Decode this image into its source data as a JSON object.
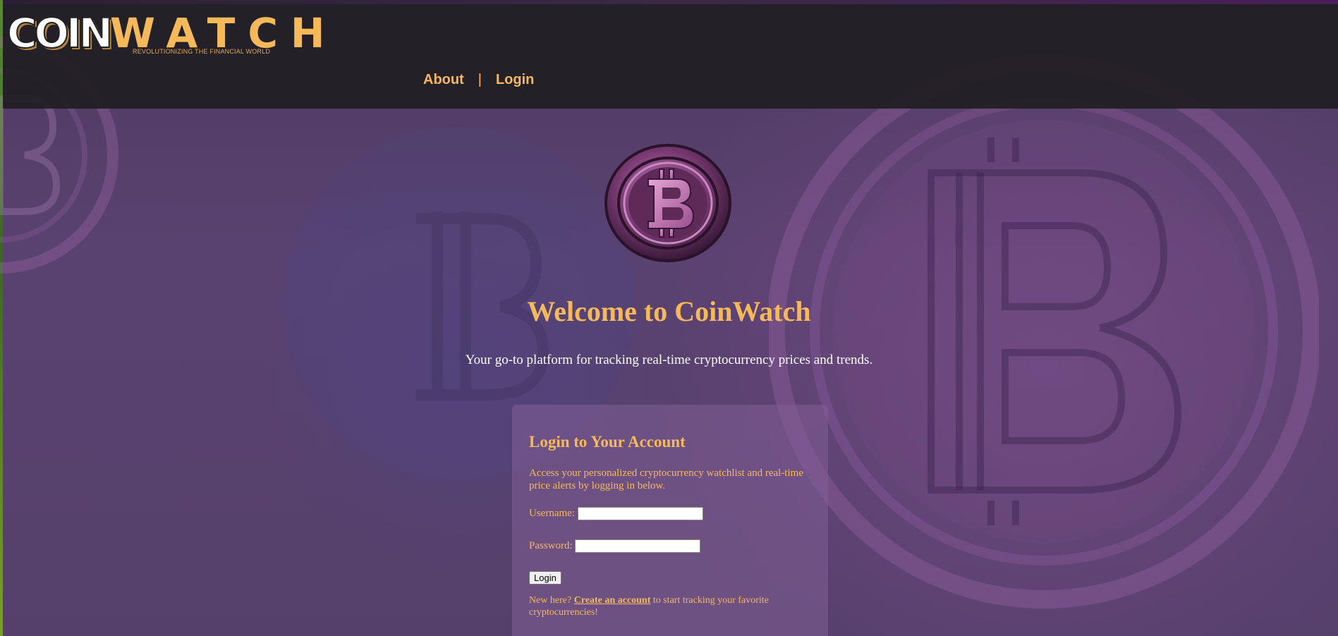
{
  "logo": {
    "part_coin": "COIN",
    "part_watch": "WATCH",
    "tagline": "REVOLUTIONIZING THE FINANCIAL WORLD"
  },
  "nav": {
    "about": "About",
    "separator": "|",
    "login": "Login"
  },
  "hero": {
    "title": "Welcome to CoinWatch",
    "subtitle": "Your go-to platform for tracking real-time cryptocurrency prices and trends."
  },
  "login_card": {
    "heading": "Login to Your Account",
    "description": "Access your personalized cryptocurrency watchlist and real-time price alerts by logging in below.",
    "username_label": "Username:",
    "username_value": "",
    "password_label": "Password:",
    "password_value": "",
    "submit_label": "Login",
    "signup_prefix": "New here?",
    "signup_link": "Create an account",
    "signup_suffix": "to start tracking your favorite cryptocurrencies!"
  },
  "colors": {
    "accent": "#f6b95a",
    "header_bg": "#201e22",
    "page_bg": "#55406b",
    "card_bg": "#7a5a90"
  },
  "icons": {
    "hero": "bitcoin-coin-icon",
    "background": "bitcoin-watermark-icon"
  }
}
